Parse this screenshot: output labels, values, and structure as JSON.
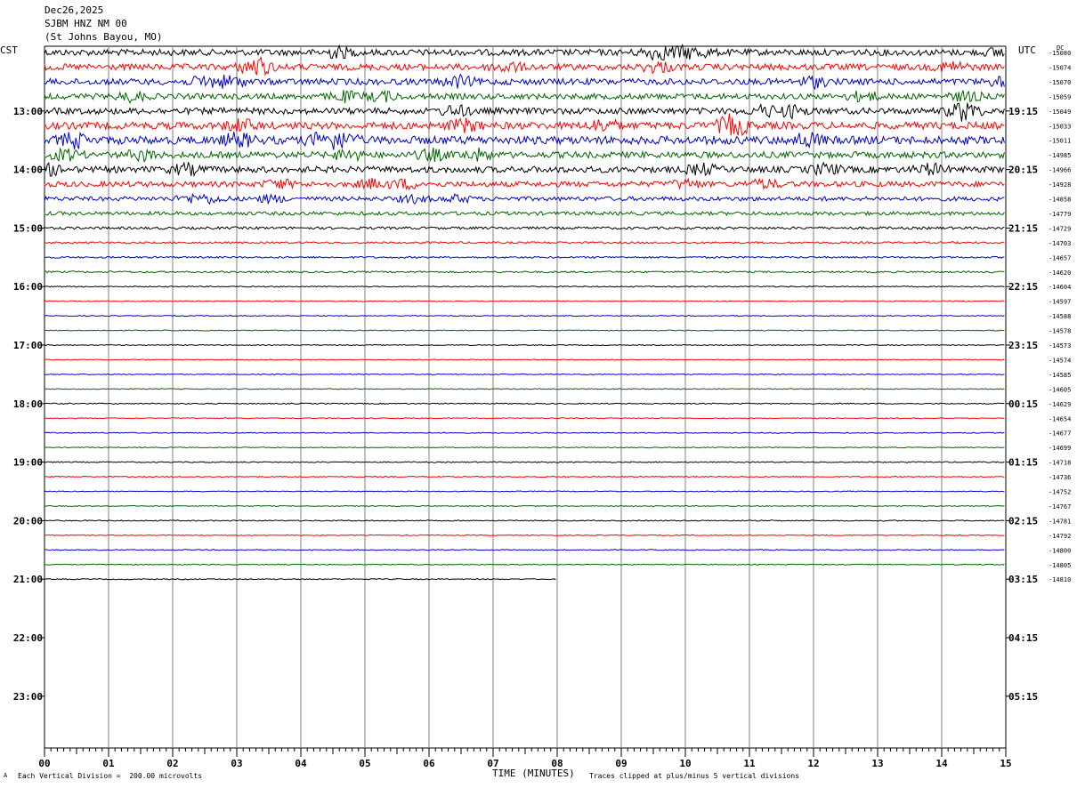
{
  "header": {
    "date": "Dec26,2025",
    "station": "SJBM HNZ NM 00",
    "location": "(St Johns Bayou, MO)"
  },
  "corner_left": "CST",
  "corner_right": "UTC",
  "dc_label": "DC",
  "footer": {
    "scale_note": "Each Vertical Division =  200.00 microvolts",
    "clip_note": "Traces clipped at plus/minus 5 vertical divisions",
    "mark": "A"
  },
  "chart_data": {
    "type": "line",
    "xlabel": "TIME (MINUTES)",
    "x_ticks": [
      "00",
      "01",
      "02",
      "03",
      "04",
      "05",
      "06",
      "07",
      "08",
      "09",
      "10",
      "11",
      "12",
      "13",
      "14",
      "15"
    ],
    "xlim": [
      0,
      15
    ],
    "left_hour_labels": [
      "13:00",
      "14:00",
      "15:00",
      "16:00",
      "17:00",
      "18:00",
      "19:00",
      "20:00",
      "21:00",
      "22:00",
      "23:00"
    ],
    "right_hour_labels": [
      "19:15",
      "20:15",
      "21:15",
      "22:15",
      "23:15",
      "00:15",
      "01:15",
      "02:15",
      "03:15",
      "04:15",
      "05:15"
    ],
    "trace_colors": [
      "#000000",
      "#ff0000",
      "#0000cc",
      "#006600"
    ],
    "dc_offsets": [
      -15080,
      -15074,
      -15070,
      -15059,
      -15049,
      -15033,
      -15011,
      -14985,
      -14966,
      -14928,
      -14858,
      -14779,
      -14729,
      -14703,
      -14657,
      -14620,
      -14604,
      -14597,
      -14588,
      -14578,
      -14573,
      -14574,
      -14585,
      -14605,
      -14629,
      -14654,
      -14677,
      -14699,
      -14718,
      -14736,
      -14752,
      -14767,
      -14781,
      -14792,
      -14800,
      -14805,
      -14810
    ],
    "noise_levels": [
      3.5,
      3.5,
      3.5,
      3.2,
      3.5,
      4,
      4.5,
      3.5,
      3.5,
      3,
      2.4,
      2,
      1.4,
      1.1,
      1,
      1,
      0.6,
      0.5,
      0.5,
      0.5,
      0.5,
      0.5,
      0.5,
      0.5,
      0.6,
      0.5,
      0.5,
      0.5,
      0.6,
      0.6,
      0.5,
      0.5,
      0.6,
      0.5,
      0.5,
      0.5,
      0.6
    ],
    "last_trace_end_minute": 8.0,
    "clip_divisions": 5,
    "scale_microvolts_per_division": 200.0
  }
}
